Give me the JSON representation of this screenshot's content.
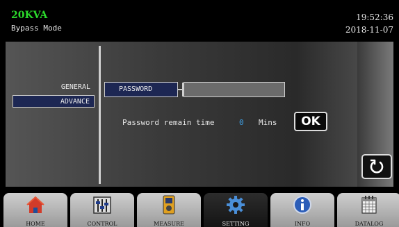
{
  "header": {
    "model": "20KVA",
    "mode": "Bypass Mode",
    "time": "19:52:36",
    "date": "2018-11-07"
  },
  "menu": {
    "general": "GENERAL",
    "advance": "ADVANCE"
  },
  "password": {
    "label": "PASSWORD",
    "value": ""
  },
  "remain": {
    "label": "Password remain time",
    "value": "0",
    "unit": "Mins"
  },
  "buttons": {
    "ok": "OK"
  },
  "nav": [
    {
      "label": "HOME",
      "icon": "home-icon"
    },
    {
      "label": "CONTROL",
      "icon": "control-sliders-icon"
    },
    {
      "label": "MEASURE",
      "icon": "measure-meter-icon"
    },
    {
      "label": "SETTING",
      "icon": "gear-icon",
      "active": true
    },
    {
      "label": "INFO",
      "icon": "info-icon"
    },
    {
      "label": "DATALOG",
      "icon": "datalog-calendar-icon"
    }
  ],
  "colors": {
    "model_text": "#2bd92b",
    "value_text": "#3fa0e6",
    "selected_bg": "#1d2753"
  }
}
